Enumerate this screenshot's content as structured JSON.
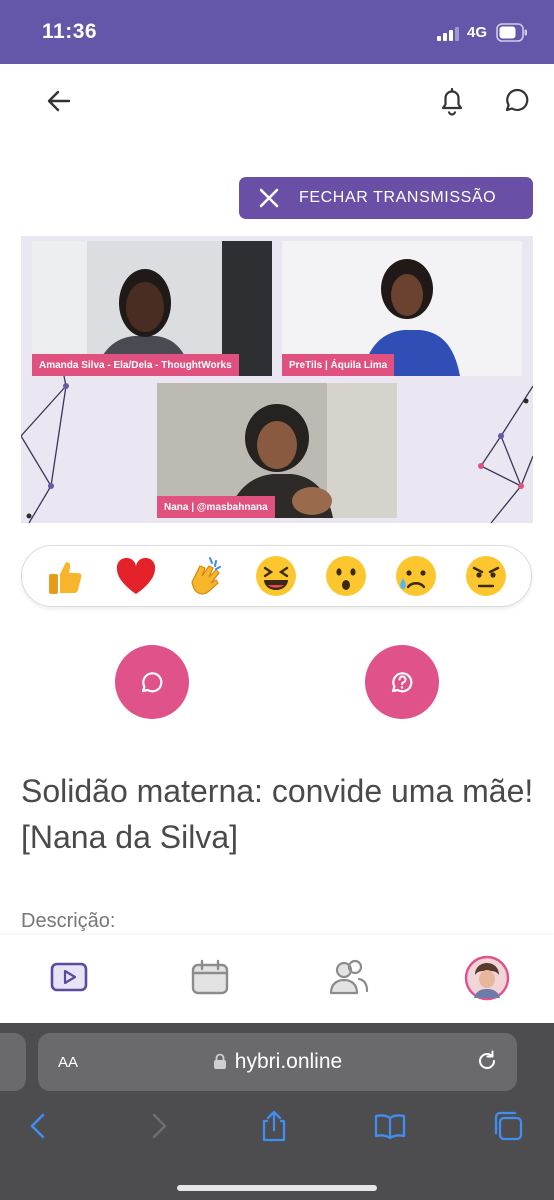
{
  "status_bar": {
    "time": "11:36",
    "network": "4G"
  },
  "close_stream_label": "FECHAR TRANSMISSÃO",
  "participants": [
    {
      "caption": "Amanda Silva - Ela/Dela - ThoughtWorks"
    },
    {
      "caption": "PreTils | Áquila Lima"
    },
    {
      "caption": "Nana | @masbahnana"
    }
  ],
  "reactions": [
    "👍",
    "❤️",
    "👏",
    "😆",
    "😯",
    "😥",
    "😠"
  ],
  "event_title": "Solidão materna: convide uma mãe! [Nana da Silva]",
  "description_label": "Descrição:",
  "browser": {
    "text_size_label": "AA",
    "url": "hybri.online"
  },
  "colors": {
    "brand": "#6456a8",
    "accent_pink": "#e0528a",
    "button_purple": "#6a4fa6"
  }
}
